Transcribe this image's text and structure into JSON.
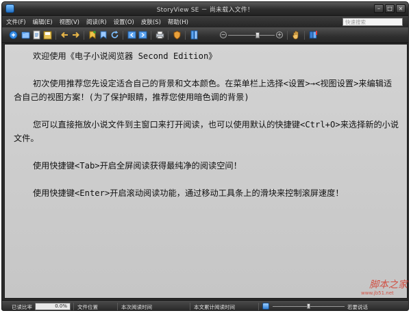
{
  "window": {
    "title": "StoryView SE － 尚未载入文件！",
    "minimize_glyph": "–",
    "maximize_glyph": "□",
    "close_glyph": "×"
  },
  "menu": {
    "items": [
      {
        "label": "文件(F)"
      },
      {
        "label": "编辑(E)"
      },
      {
        "label": "视图(V)"
      },
      {
        "label": "阅读(R)"
      },
      {
        "label": "设置(O)"
      },
      {
        "label": "皮肤(S)"
      },
      {
        "label": "帮助(H)"
      }
    ]
  },
  "search": {
    "placeholder": "快速搜索"
  },
  "toolbar": {
    "icons": [
      "app-logo-icon",
      "open-folder-icon",
      "recent-file-icon",
      "save-icon",
      "back-icon",
      "forward-icon",
      "bookmark-add-icon",
      "bookmark-icon",
      "refresh-icon",
      "prev-page-icon",
      "next-page-icon",
      "print-icon",
      "shield-icon",
      "column-icon",
      "hand-icon",
      "book-icon"
    ],
    "zoom_minus": "−",
    "zoom_plus": "+",
    "zoom_level": 0.5
  },
  "content": {
    "paragraphs": [
      "欢迎使用《电子小说阅览器 Second Edition》",
      "初次使用推荐您先设定适合自己的背景和文本颜色。在菜单栏上选择<设置>→<视图设置>来编辑适合自己的视图方案！(为了保护眼睛，推荐您使用暗色调的背景)",
      "您可以直接拖放小说文件到主窗口来打开阅读，也可以使用默认的快捷键<Ctrl+O>来选择新的小说文件。",
      "使用快捷键<Tab>开启全屏阅读获得最纯净的阅读空间！",
      "使用快捷键<Enter>开启滚动阅读功能，通过移动工具条上的滑块来控制滚屏速度！"
    ]
  },
  "watermark": {
    "text": "脚本之家",
    "sub": "www.jb51.net"
  },
  "statusbar": {
    "read_ratio_label": "已读比率",
    "read_ratio_value": "0.0%",
    "read_ratio_fraction": 0,
    "file_position": "文件位置",
    "session_time": "本次阅读时间",
    "total_time": "本文累计阅读时间",
    "speed_label": "若要说话",
    "speed_level": 0.5
  },
  "colors": {
    "content_bg": "#cfcfcf",
    "chrome": "#2b2b2b",
    "accent": "#2f7fd6"
  }
}
